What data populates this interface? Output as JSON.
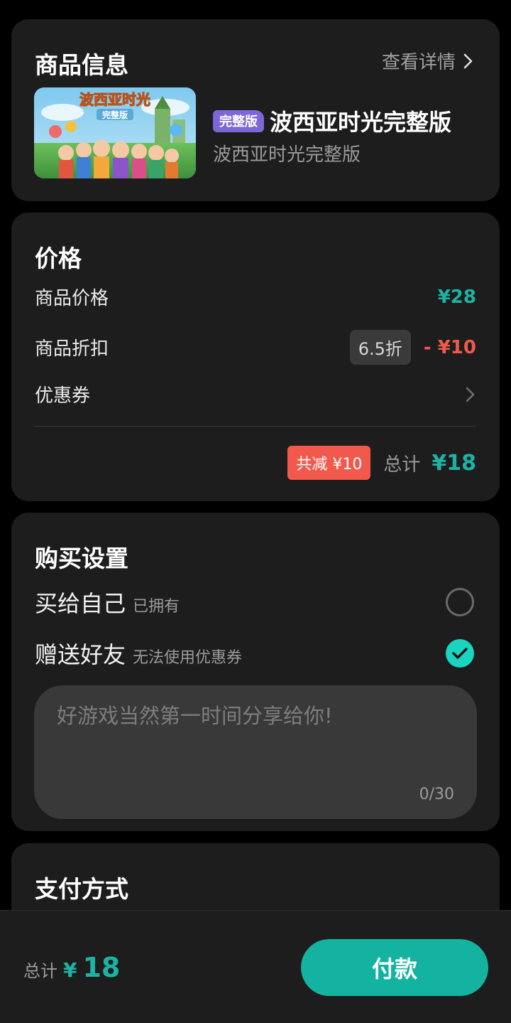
{
  "product": {
    "title": "商品信息",
    "detail_link": "查看详情",
    "thumb_title": "波西亚时光",
    "thumb_badge": "完整版",
    "edition_badge": "完整版",
    "name": "波西亚时光完整版",
    "subtitle": "波西亚时光完整版"
  },
  "price": {
    "title": "价格",
    "item_price_label": "商品价格",
    "item_price_value": "¥28",
    "discount_label": "商品折扣",
    "discount_rate": "6.5折",
    "discount_value": "- ¥10",
    "coupon_label": "优惠券",
    "saved_badge": "共减 ¥10",
    "total_label": "总计",
    "total_value": "¥18"
  },
  "purchase": {
    "title": "购买设置",
    "self_label": "买给自己",
    "self_note": "已拥有",
    "gift_label": "赠送好友",
    "gift_note": "无法使用优惠券",
    "message_placeholder": "好游戏当然第一时间分享给你!",
    "message_count": "0/30"
  },
  "payment": {
    "title": "支付方式"
  },
  "bottom_bar": {
    "total_label": "总计",
    "yen": "¥",
    "total_number": "18",
    "pay_button": "付款"
  },
  "colors": {
    "accent_teal": "#1cb3a4",
    "discount_red": "#ef5a4d",
    "card_bg": "#1d1d1d",
    "badge_purple": "#7d67d8"
  }
}
